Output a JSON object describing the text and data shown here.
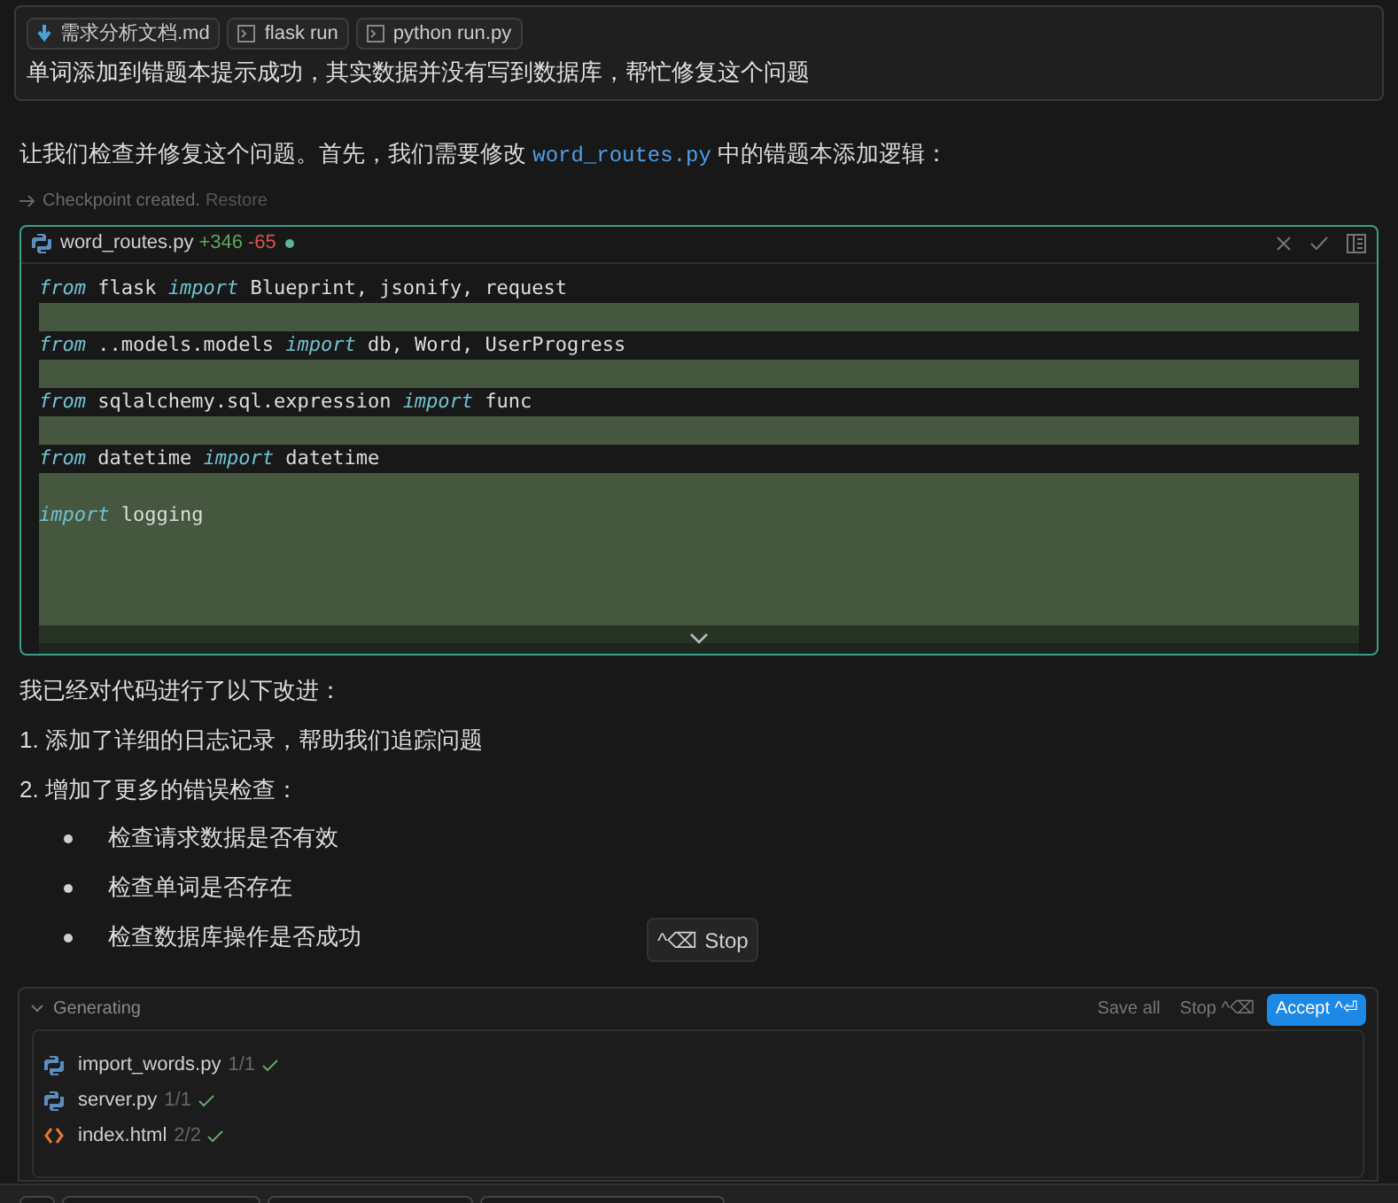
{
  "user_message": {
    "attachments": [
      {
        "kind": "markdown",
        "label": "需求分析文档.md"
      },
      {
        "kind": "terminal",
        "label": "flask run"
      },
      {
        "kind": "terminal",
        "label": "python run.py"
      }
    ],
    "text": "单词添加到错题本提示成功，其实数据并没有写到数据库，帮忙修复这个问题"
  },
  "intro": {
    "before": "让我们检查并修复这个问题。首先，我们需要修改",
    "code": "word_routes.py",
    "after": "中的错题本添加逻辑："
  },
  "checkpoint": {
    "text": "Checkpoint created.",
    "action": "Restore"
  },
  "diff": {
    "file": "word_routes.py",
    "added": "+346",
    "removed": "-65",
    "unsaved": true,
    "lines": [
      {
        "kind": "context",
        "segments": [
          {
            "kind": "keyword",
            "text": "from"
          },
          {
            "kind": "plain",
            "text": " flask "
          },
          {
            "kind": "keyword",
            "text": "import"
          },
          {
            "kind": "plain",
            "text": " Blueprint, jsonify, request"
          }
        ]
      },
      {
        "kind": "added"
      },
      {
        "kind": "context",
        "segments": [
          {
            "kind": "keyword",
            "text": "from"
          },
          {
            "kind": "plain",
            "text": " ..models.models "
          },
          {
            "kind": "keyword",
            "text": "import"
          },
          {
            "kind": "plain",
            "text": " db, Word, UserProgress"
          }
        ]
      },
      {
        "kind": "added"
      },
      {
        "kind": "context",
        "segments": [
          {
            "kind": "keyword",
            "text": "from"
          },
          {
            "kind": "plain",
            "text": " sqlalchemy.sql.expression "
          },
          {
            "kind": "keyword",
            "text": "import"
          },
          {
            "kind": "plain",
            "text": " func"
          }
        ]
      },
      {
        "kind": "added"
      },
      {
        "kind": "context",
        "segments": [
          {
            "kind": "keyword",
            "text": "from"
          },
          {
            "kind": "plain",
            "text": " datetime "
          },
          {
            "kind": "keyword",
            "text": "import"
          },
          {
            "kind": "plain",
            "text": " datetime"
          }
        ]
      },
      {
        "kind": "added"
      },
      {
        "kind": "added",
        "segments": [
          {
            "kind": "keyword",
            "text": "import"
          },
          {
            "kind": "plain",
            "text": " logging"
          }
        ]
      },
      {
        "kind": "added"
      },
      {
        "kind": "added"
      },
      {
        "kind": "added"
      },
      {
        "kind": "added"
      }
    ]
  },
  "summary": [
    {
      "kind": "paragraph",
      "text": "我已经对代码进行了以下改进："
    },
    {
      "kind": "paragraph",
      "text": "1. 添加了详细的日志记录，帮助我们追踪问题"
    },
    {
      "kind": "paragraph",
      "text": "2. 增加了更多的错误检查："
    },
    {
      "kind": "bullet",
      "text": "检查请求数据是否有效"
    },
    {
      "kind": "bullet",
      "text": "检查单词是否存在"
    },
    {
      "kind": "bullet",
      "text": "检查数据库操作是否成功"
    }
  ],
  "stop_button": {
    "shortcut": "^⌫",
    "label": "Stop"
  },
  "generating_panel": {
    "title": "Generating",
    "expanded": true,
    "save_all": "Save all",
    "stop": "Stop ^⌫",
    "accept": "Accept ^⏎",
    "files": [
      {
        "kind": "python",
        "name": "import_words.py",
        "count": "1/1",
        "done": true
      },
      {
        "kind": "python",
        "name": "server.py",
        "count": "1/1",
        "done": true
      },
      {
        "kind": "html",
        "name": "index.html",
        "count": "2/2",
        "done": true
      }
    ]
  }
}
